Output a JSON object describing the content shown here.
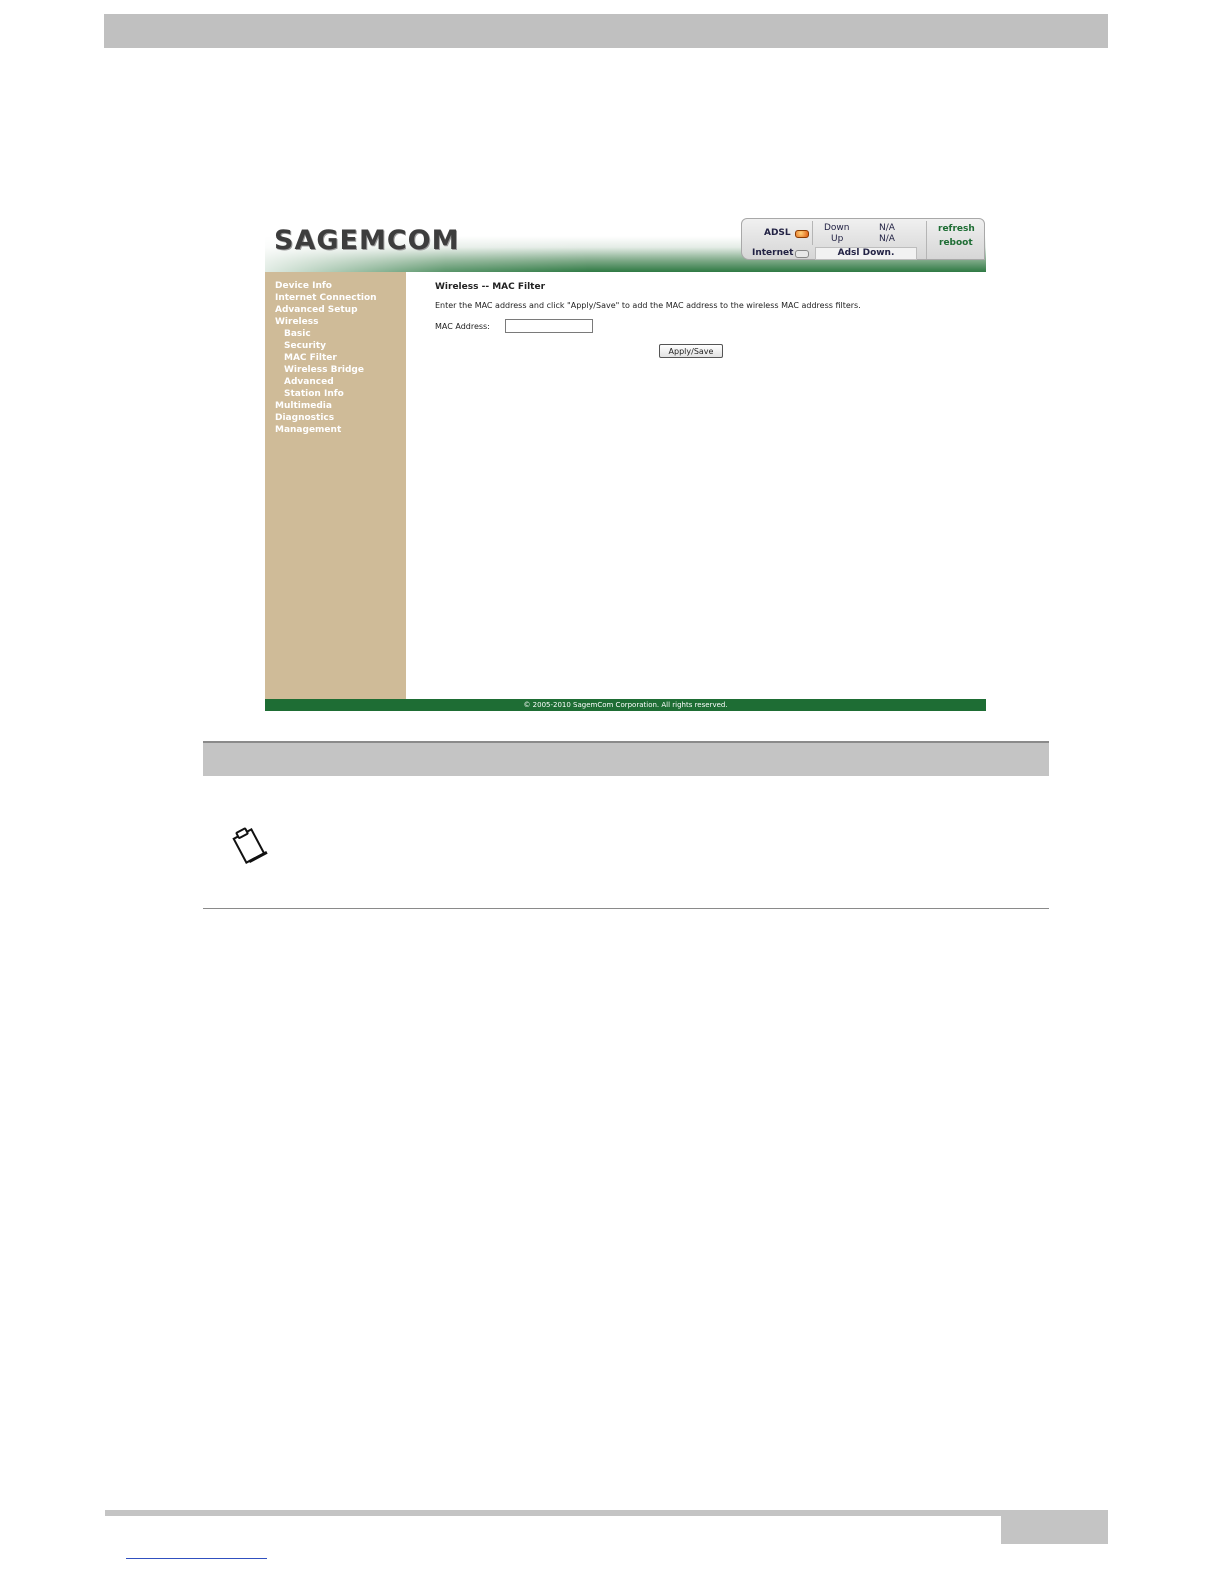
{
  "router": {
    "logo_text": "SAGEMCOM",
    "status": {
      "adsl_label": "ADSL",
      "internet_label": "Internet",
      "down_label": "Down",
      "up_label": "Up",
      "down_value": "N/A",
      "up_value": "N/A",
      "adsl_status": "Adsl Down.",
      "refresh_label": "refresh",
      "reboot_label": "reboot",
      "adsl_led_color": "#e05a10",
      "internet_led_color": "#e8e8e8"
    },
    "sidebar": {
      "items": [
        {
          "label": "Device Info"
        },
        {
          "label": "Internet Connection"
        },
        {
          "label": "Advanced Setup"
        },
        {
          "label": "Wireless"
        },
        {
          "label": "Basic"
        },
        {
          "label": "Security"
        },
        {
          "label": "MAC Filter"
        },
        {
          "label": "Wireless Bridge"
        },
        {
          "label": "Advanced"
        },
        {
          "label": "Station Info"
        },
        {
          "label": "Multimedia"
        },
        {
          "label": "Diagnostics"
        },
        {
          "label": "Management"
        }
      ]
    },
    "content": {
      "title": "Wireless -- MAC Filter",
      "description": "Enter the MAC address and click \"Apply/Save\" to add the MAC address to the wireless MAC address filters.",
      "mac_label": "MAC Address:",
      "mac_value": "",
      "apply_label": "Apply/Save"
    },
    "footer_text": "© 2005-2010 SagemCom Corporation. All rights reserved."
  },
  "colors": {
    "brand_green": "#1e6d34",
    "sidebar_tan": "#cfbb98",
    "doc_gray": "#c0c0c0"
  },
  "icons": {
    "note": "clipboard-note-icon"
  }
}
